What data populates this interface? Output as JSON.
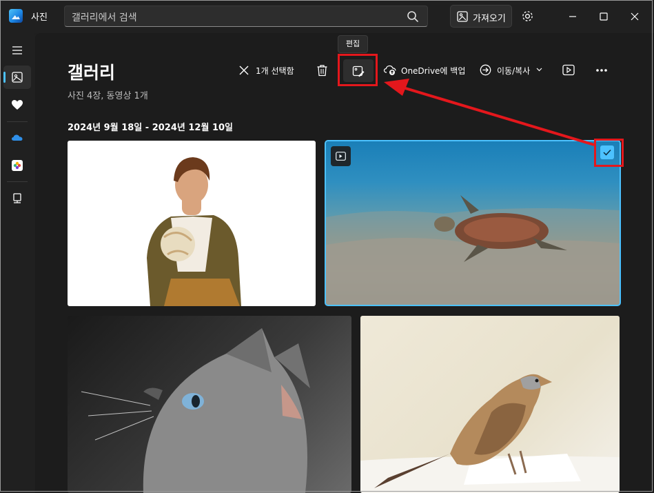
{
  "app": {
    "title": "사진"
  },
  "search": {
    "placeholder": "갤러리에서 검색"
  },
  "header": {
    "import_label": "가져오기"
  },
  "page": {
    "title": "갤러리",
    "subtitle": "사진 4장, 동영상 1개",
    "date_range": "2024년 9월 18일 - 2024년 12월 10일"
  },
  "toolbar": {
    "selected_label": "1개 선택함",
    "edit_tooltip": "편집",
    "onedrive_label": "OneDrive에 백업",
    "move_copy_label": "이동/복사"
  },
  "colors": {
    "accent": "#4cc2ff",
    "highlight": "#e4171c",
    "background": "#1c1c1c"
  },
  "photos": [
    {
      "subject": "man-with-globe"
    },
    {
      "subject": "sea-turtle-video",
      "selected": true
    },
    {
      "subject": "gray-cat"
    },
    {
      "subject": "sparrow"
    }
  ]
}
